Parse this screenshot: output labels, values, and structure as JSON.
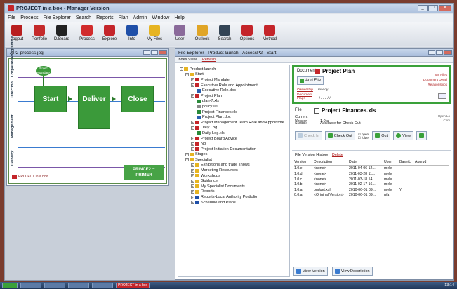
{
  "app": {
    "title": "PROJECT in a box - Manager Version"
  },
  "menu": [
    "File",
    "Process",
    "File Explorer",
    "Search",
    "Reports",
    "Plan",
    "Admin",
    "Window",
    "Help"
  ],
  "toolbar": [
    {
      "label": "Logout",
      "icon": "logout-icon",
      "color": "#b81f1f"
    },
    {
      "label": "Portfolio",
      "icon": "portfolio-icon",
      "color": "#c42a2a"
    },
    {
      "label": "D/Board",
      "icon": "dashboard-icon",
      "color": "#222222"
    },
    {
      "label": "Process",
      "icon": "process-icon",
      "color": "#d12b2b"
    },
    {
      "label": "Explore",
      "icon": "explore-icon",
      "color": "#c4252a"
    },
    {
      "label": "Info",
      "icon": "info-icon",
      "color": "#1f4fa8"
    },
    {
      "label": "My Files",
      "icon": "myfiles-icon",
      "color": "#e6b422"
    },
    {
      "label": "User",
      "icon": "user-icon",
      "color": "#8a6a9a"
    },
    {
      "label": "Outlook",
      "icon": "outlook-icon",
      "color": "#e0a526"
    },
    {
      "label": "Search",
      "icon": "search-icon",
      "color": "#334455"
    },
    {
      "label": "Options",
      "icon": "options-icon",
      "color": "#c4252a"
    },
    {
      "label": "Method",
      "icon": "method-icon",
      "color": "#c4252a"
    }
  ],
  "process_window": {
    "title": "AP2-process.jpg",
    "lanes": [
      "Corporate/Programme",
      "Direction",
      "Management",
      "Delivery"
    ],
    "pm_label": "Project Mandate",
    "steps": [
      "Start",
      "Deliver",
      "Close"
    ],
    "primer": "PRINCE2™ PRIMER",
    "brand": "PROJECT in a box"
  },
  "explorer_window": {
    "title": "File Explorer - Product launch - AccessP2 - Start",
    "subbar": [
      "Index View",
      "Refresh"
    ],
    "tree": [
      {
        "label": "Product launch",
        "level": 0,
        "icon": "folder-icon",
        "color": "#e6b422"
      },
      {
        "label": "Start",
        "level": 1,
        "icon": "folder-icon",
        "color": "#e6b422"
      },
      {
        "label": "Project Mandate",
        "level": 2,
        "icon": "doc-icon",
        "color": "#c4252a"
      },
      {
        "label": "Executive Role and Appointment",
        "level": 2,
        "icon": "doc-icon",
        "color": "#c4252a"
      },
      {
        "label": "Executive Role.doc",
        "level": 3,
        "icon": "file-icon",
        "color": "#2b5fb0"
      },
      {
        "label": "Project Plan",
        "level": 2,
        "icon": "doc-icon",
        "color": "#c4252a"
      },
      {
        "label": "plan-7.xls",
        "level": 3,
        "icon": "file-icon",
        "color": "#2a8a3a"
      },
      {
        "label": "policy.url",
        "level": 3,
        "icon": "file-icon",
        "color": "#888888"
      },
      {
        "label": "Project Finances.xls",
        "level": 3,
        "icon": "file-icon",
        "color": "#2a8a3a"
      },
      {
        "label": "Project Plan.doc",
        "level": 3,
        "icon": "file-icon",
        "color": "#2b5fb0"
      },
      {
        "label": "Project Management Team Role and Appointme",
        "level": 2,
        "icon": "doc-icon",
        "color": "#c4252a"
      },
      {
        "label": "Daily Log",
        "level": 2,
        "icon": "doc-icon",
        "color": "#c4252a"
      },
      {
        "label": "Daily Log.xls",
        "level": 3,
        "icon": "file-icon",
        "color": "#2a8a3a"
      },
      {
        "label": "Project Board Advice",
        "level": 2,
        "icon": "doc-icon",
        "color": "#c4252a"
      },
      {
        "label": "Nb",
        "level": 2,
        "icon": "doc-icon",
        "color": "#c4252a"
      },
      {
        "label": "Project Initiation Documentation",
        "level": 2,
        "icon": "doc-icon",
        "color": "#c4252a"
      },
      {
        "label": "Stages",
        "level": 1,
        "icon": "folder-icon",
        "color": "#e6b422"
      },
      {
        "label": "Specialist",
        "level": 1,
        "icon": "folder-icon",
        "color": "#e6b422"
      },
      {
        "label": "Exhibitions and trade shows",
        "level": 2,
        "icon": "folder-icon",
        "color": "#e6b422"
      },
      {
        "label": "Marketing Resources",
        "level": 2,
        "icon": "folder-icon",
        "color": "#e6b422"
      },
      {
        "label": "Workshops",
        "level": 2,
        "icon": "folder-icon",
        "color": "#e6b422"
      },
      {
        "label": "Guidance",
        "level": 2,
        "icon": "folder-icon",
        "color": "#e6b422"
      },
      {
        "label": "My Specialist Documents",
        "level": 2,
        "icon": "folder-icon",
        "color": "#e6b422"
      },
      {
        "label": "Reports",
        "level": 2,
        "icon": "folder-icon",
        "color": "#e6b422"
      },
      {
        "label": "Reports-Local Authority Portfolio",
        "level": 2,
        "icon": "folder-icon",
        "color": "#1f4fa8"
      },
      {
        "label": "Schedule and Plans",
        "level": 2,
        "icon": "folder-icon",
        "color": "#1f4fa8"
      }
    ],
    "document": {
      "label": "Document:",
      "title": "Project Plan",
      "add_file": "Add File",
      "links": [
        "My Files",
        "Document Detail",
        "Relationships"
      ],
      "kv": [
        {
          "k": "Ownership",
          "v": "maddy"
        },
        {
          "k": "Document Flags",
          "v": "-/-/-/-/-/-/-"
        }
      ]
    },
    "file": {
      "label": "File",
      "title": "Project Finances.xls",
      "current_version_label": "Current Version",
      "current_version": "1.0.e",
      "status_label": "Status:",
      "status": "Available for Check Out",
      "right_text": [
        "Open Lo",
        "Com"
      ],
      "buttons": {
        "check_in": "Check In",
        "check_out": "Check Out",
        "open_label": "open",
        "folder_label": "folder",
        "out": "Out",
        "view": "View"
      }
    },
    "history": {
      "title": "File Version History",
      "link": "Delete",
      "columns": [
        "Version",
        "Description",
        "Date",
        "User",
        "Base/L",
        "Apprvd"
      ],
      "rows": [
        [
          "1.0.e",
          "<none>",
          "2011-04-06 12...",
          "mele",
          "",
          ""
        ],
        [
          "1.0.d",
          "<none>",
          "2011-03-28 11...",
          "mele",
          "",
          ""
        ],
        [
          "1.0.c",
          "<none>",
          "2011-03-18 14...",
          "mele",
          "",
          ""
        ],
        [
          "1.0.b",
          "<none>",
          "2011-02-17 16...",
          "mele",
          "",
          ""
        ],
        [
          "1.0.a",
          "budget.xsl",
          "2010-06-01 09...",
          "mele",
          "Y",
          ""
        ],
        [
          "0.0.a",
          "<Original Version>",
          "2010-06-01 09...",
          "n/a",
          "",
          ""
        ]
      ],
      "view_version": "View Version",
      "view_description": "View Description"
    }
  },
  "taskbar": {
    "items": [
      "",
      "",
      "",
      "",
      "PROJECT in a box"
    ],
    "clock": "13:14"
  }
}
